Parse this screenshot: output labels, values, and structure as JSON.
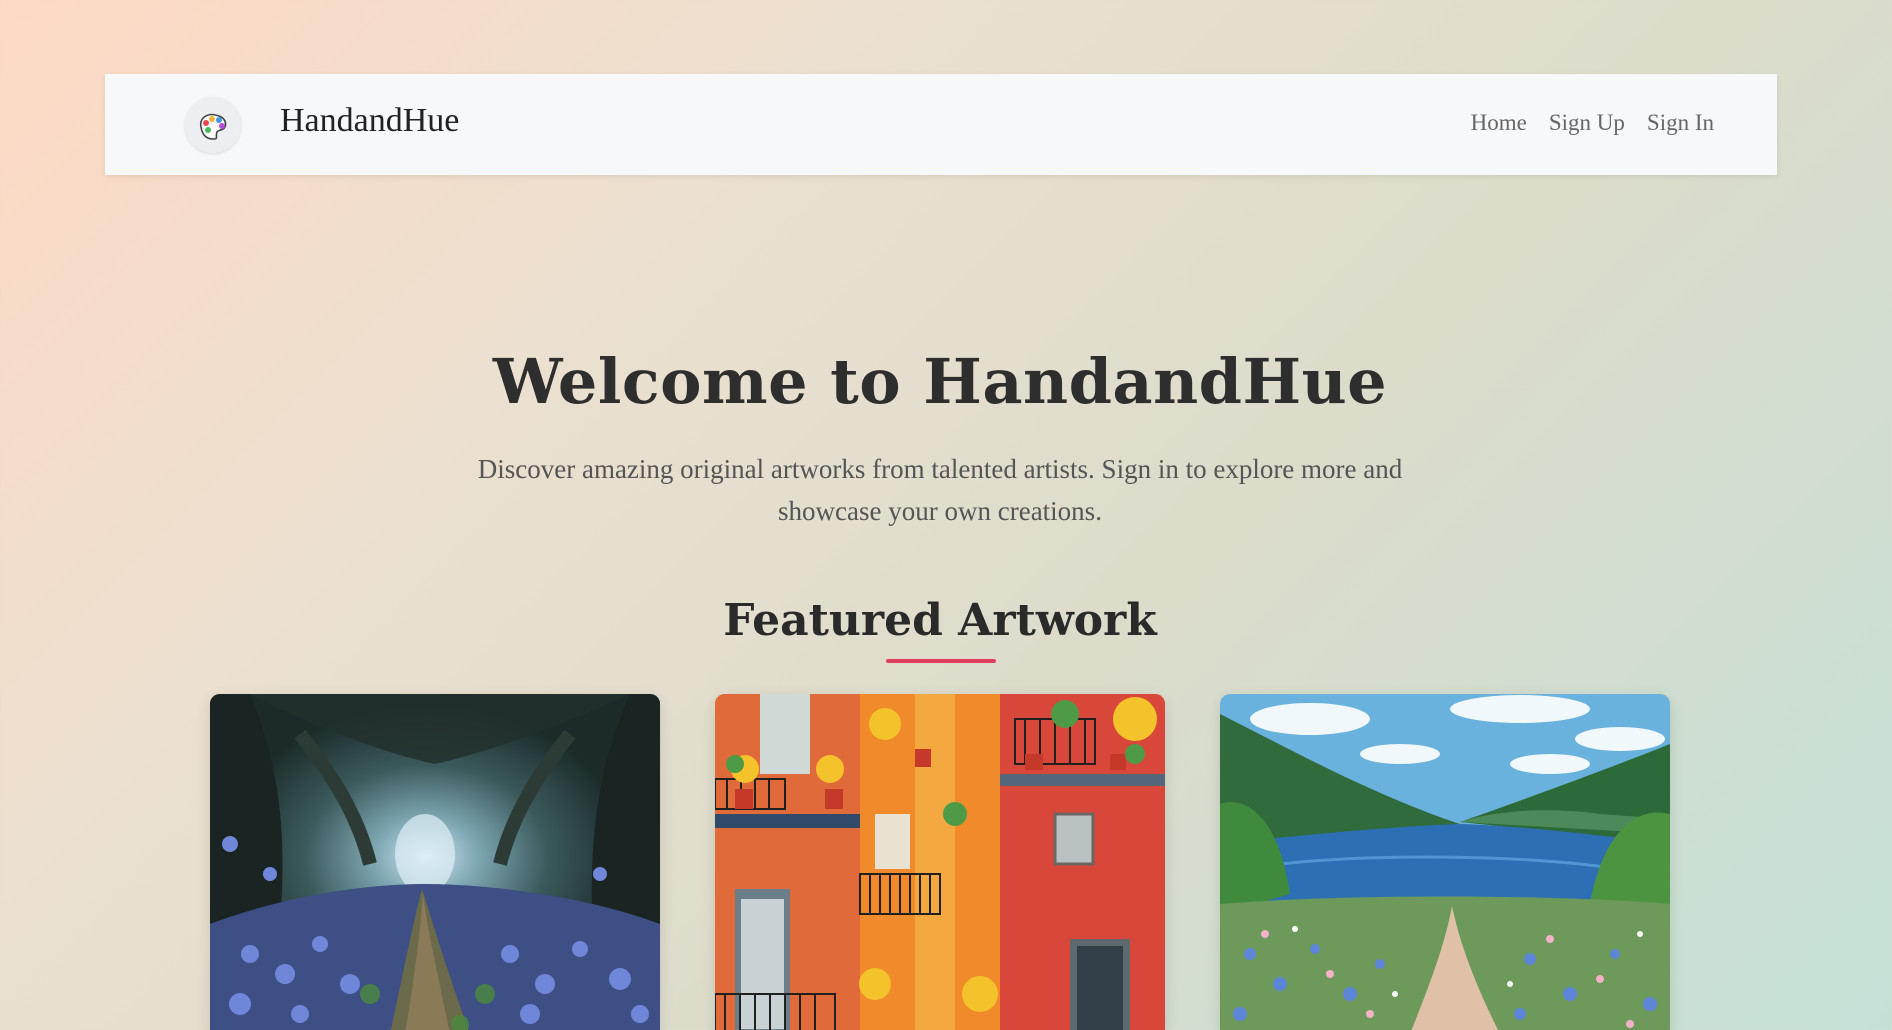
{
  "navbar": {
    "brand": "HandandHue",
    "logo_icon": "palette-icon",
    "links": [
      {
        "label": "Home"
      },
      {
        "label": "Sign Up"
      },
      {
        "label": "Sign In"
      }
    ]
  },
  "hero": {
    "title": "Welcome to HandandHue",
    "subtitle": "Discover amazing original artworks from talented artists. Sign in to explore more and showcase your own creations."
  },
  "featured": {
    "title": "Featured Artwork",
    "accent_color": "#e0405e",
    "artworks": [
      {
        "subject": "forest-path-bluebells"
      },
      {
        "subject": "colorful-buildings-balconies"
      },
      {
        "subject": "lake-valley-wildflowers"
      }
    ]
  }
}
